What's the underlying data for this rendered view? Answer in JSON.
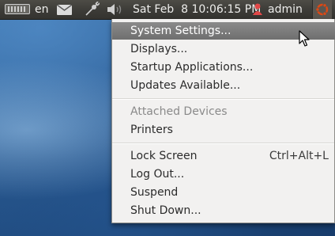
{
  "panel": {
    "language": "en",
    "clock": "Sat Feb  8 10:06:15 PM",
    "user": "admin"
  },
  "menu": {
    "items": [
      {
        "label": "System Settings..."
      },
      {
        "label": "Displays..."
      },
      {
        "label": "Startup Applications..."
      },
      {
        "label": "Updates Available..."
      },
      {
        "label": "Attached Devices"
      },
      {
        "label": "Printers"
      },
      {
        "label": "Lock Screen",
        "accel": "Ctrl+Alt+L"
      },
      {
        "label": "Log Out..."
      },
      {
        "label": "Suspend"
      },
      {
        "label": "Shut Down..."
      }
    ]
  },
  "colors": {
    "panel": "#3c3b37",
    "menu_bg": "#f2f1f0",
    "highlight": "#7a7a7a",
    "ubuntu_orange": "#dd4814"
  }
}
